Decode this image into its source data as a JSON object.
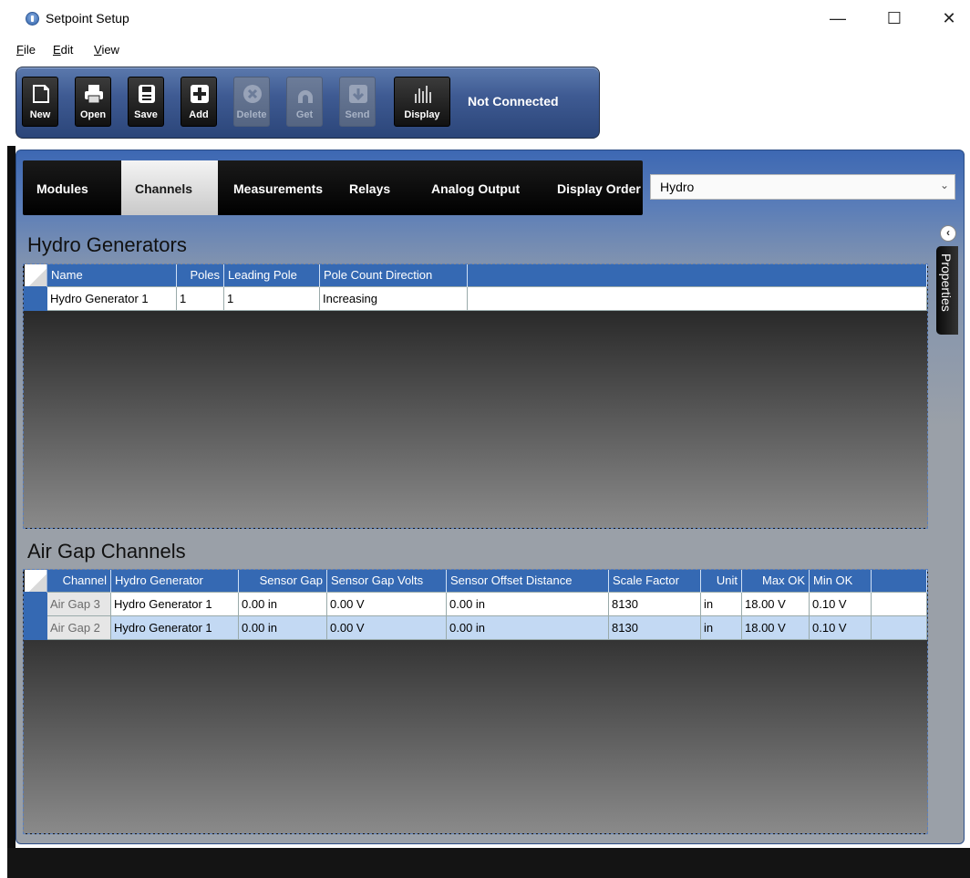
{
  "window": {
    "title": "Setpoint Setup",
    "min": "—",
    "max": "☐",
    "close": "✕"
  },
  "menu": [
    {
      "accel": "F",
      "rest": "ile"
    },
    {
      "accel": "E",
      "rest": "dit"
    },
    {
      "accel": "V",
      "rest": "iew"
    }
  ],
  "toolbar": {
    "buttons": [
      {
        "label": "New",
        "icon": "new-icon",
        "enabled": true
      },
      {
        "label": "Open",
        "icon": "printer-icon",
        "enabled": true
      },
      {
        "label": "Save",
        "icon": "floppy-icon",
        "enabled": true
      },
      {
        "label": "Add",
        "icon": "plus-icon",
        "enabled": true
      },
      {
        "label": "Delete",
        "icon": "delete-icon",
        "enabled": false
      },
      {
        "label": "Get",
        "icon": "get-icon",
        "enabled": false
      },
      {
        "label": "Send",
        "icon": "send-icon",
        "enabled": false
      },
      {
        "label": "Display",
        "icon": "bar-chart-icon",
        "enabled": true
      }
    ],
    "status": "Not Connected"
  },
  "tabs": [
    "Modules",
    "Channels",
    "Measurements",
    "Relays",
    "Analog Output",
    "Display Order"
  ],
  "active_tab": "Channels",
  "module_select": "Hydro",
  "properties_label": "Properties",
  "hydro": {
    "title": "Hydro Generators",
    "columns": [
      "Name",
      "Poles",
      "Leading Pole",
      "Pole Count Direction"
    ],
    "rows": [
      [
        "Hydro Generator 1",
        "1",
        "1",
        "Increasing"
      ]
    ]
  },
  "airgap": {
    "title": "Air Gap Channels",
    "columns": [
      "Channel",
      "Hydro Generator",
      "Sensor Gap",
      "Sensor Gap Volts",
      "Sensor Offset Distance",
      "Scale Factor",
      "Unit",
      "Max OK",
      "Min OK"
    ],
    "rows": [
      [
        "Air Gap 3",
        "Hydro Generator 1",
        "0.00 in",
        "0.00 V",
        "0.00 in",
        "8130",
        "in",
        "18.00 V",
        "0.10 V"
      ],
      [
        "Air Gap 2",
        "Hydro Generator 1",
        "0.00 in",
        "0.00 V",
        "0.00 in",
        "8130",
        "in",
        "18.00 V",
        "0.10 V"
      ]
    ],
    "selected_row": 1
  },
  "colors": {
    "header_blue": "#3569b3",
    "selected_row": "#c3d9f3",
    "toolbar_blue": "#3f5b93"
  }
}
